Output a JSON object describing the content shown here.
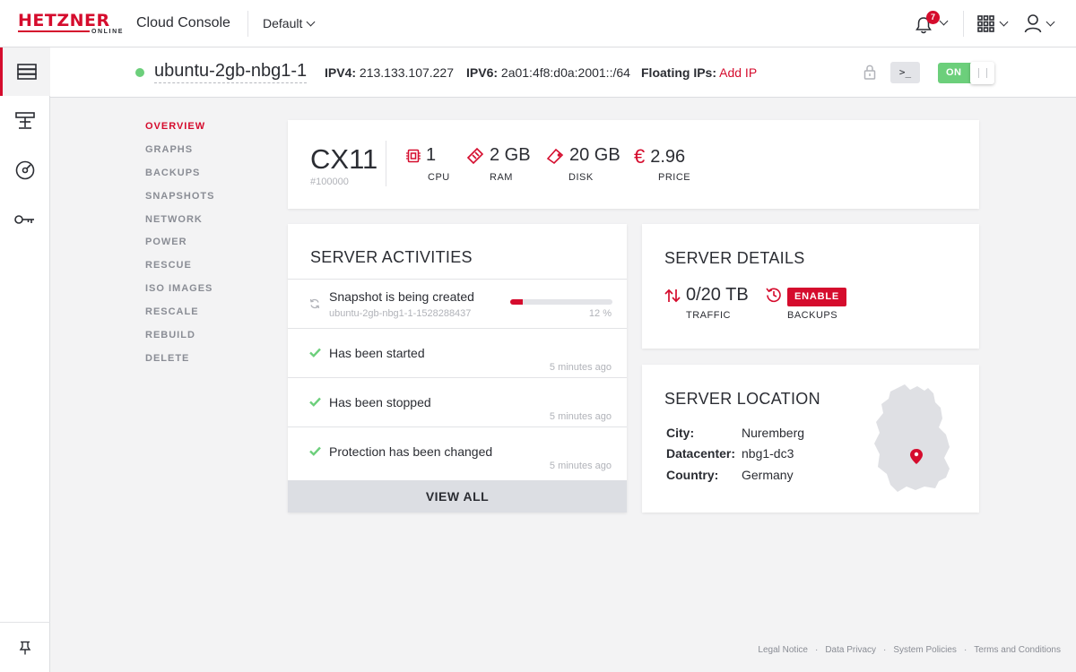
{
  "brand": {
    "logo_main": "HETZNER",
    "logo_sub": "ONLINE",
    "accent": "#d50c2d",
    "app_title": "Cloud Console"
  },
  "header": {
    "project": "Default",
    "notification_count": "7"
  },
  "rail": {
    "items": [
      "servers-icon",
      "load-balancer-icon",
      "volumes-icon",
      "security-key-icon"
    ],
    "pin_icon": "pin-icon"
  },
  "server": {
    "status_color": "#6ccf7b",
    "name": "ubuntu-2gb-nbg1-1",
    "ipv4_label": "IPV4:",
    "ipv4": "213.133.107.227",
    "ipv6_label": "IPV6:",
    "ipv6": "2a01:4f8:d0a:2001::/64",
    "floating_label": "Floating IPs:",
    "floating_action": "Add IP",
    "console_label": ">_",
    "power_toggle": "ON"
  },
  "subnav": [
    "OVERVIEW",
    "GRAPHS",
    "BACKUPS",
    "SNAPSHOTS",
    "NETWORK",
    "POWER",
    "RESCUE",
    "ISO IMAGES",
    "RESCALE",
    "REBUILD",
    "DELETE"
  ],
  "specs": {
    "type": "CX11",
    "id": "#100000",
    "cpu_value": "1",
    "cpu_label": "CPU",
    "ram_value": "2 GB",
    "ram_label": "RAM",
    "disk_value": "20 GB",
    "disk_label": "DISK",
    "price_value": "2.96",
    "price_label": "PRICE",
    "currency": "€"
  },
  "activities": {
    "title": "SERVER ACTIVITIES",
    "current": {
      "text": "Snapshot is being created",
      "sub": "ubuntu-2gb-nbg1-1-1528288437",
      "progress": 12,
      "progress_label": "12 %"
    },
    "items": [
      {
        "text": "Has been started",
        "time": "5 minutes ago"
      },
      {
        "text": "Has been stopped",
        "time": "5 minutes ago"
      },
      {
        "text": "Protection has been changed",
        "time": "5 minutes ago"
      }
    ],
    "view_all": "VIEW ALL"
  },
  "details": {
    "title": "SERVER DETAILS",
    "traffic_value": "0/20 TB",
    "traffic_label": "TRAFFIC",
    "backups_action": "ENABLE",
    "backups_label": "BACKUPS"
  },
  "location": {
    "title": "SERVER LOCATION",
    "city_label": "City:",
    "city": "Nuremberg",
    "datacenter_label": "Datacenter:",
    "datacenter": "nbg1-dc3",
    "country_label": "Country:",
    "country": "Germany"
  },
  "footer": [
    "Legal Notice",
    "Data Privacy",
    "System Policies",
    "Terms and Conditions"
  ]
}
